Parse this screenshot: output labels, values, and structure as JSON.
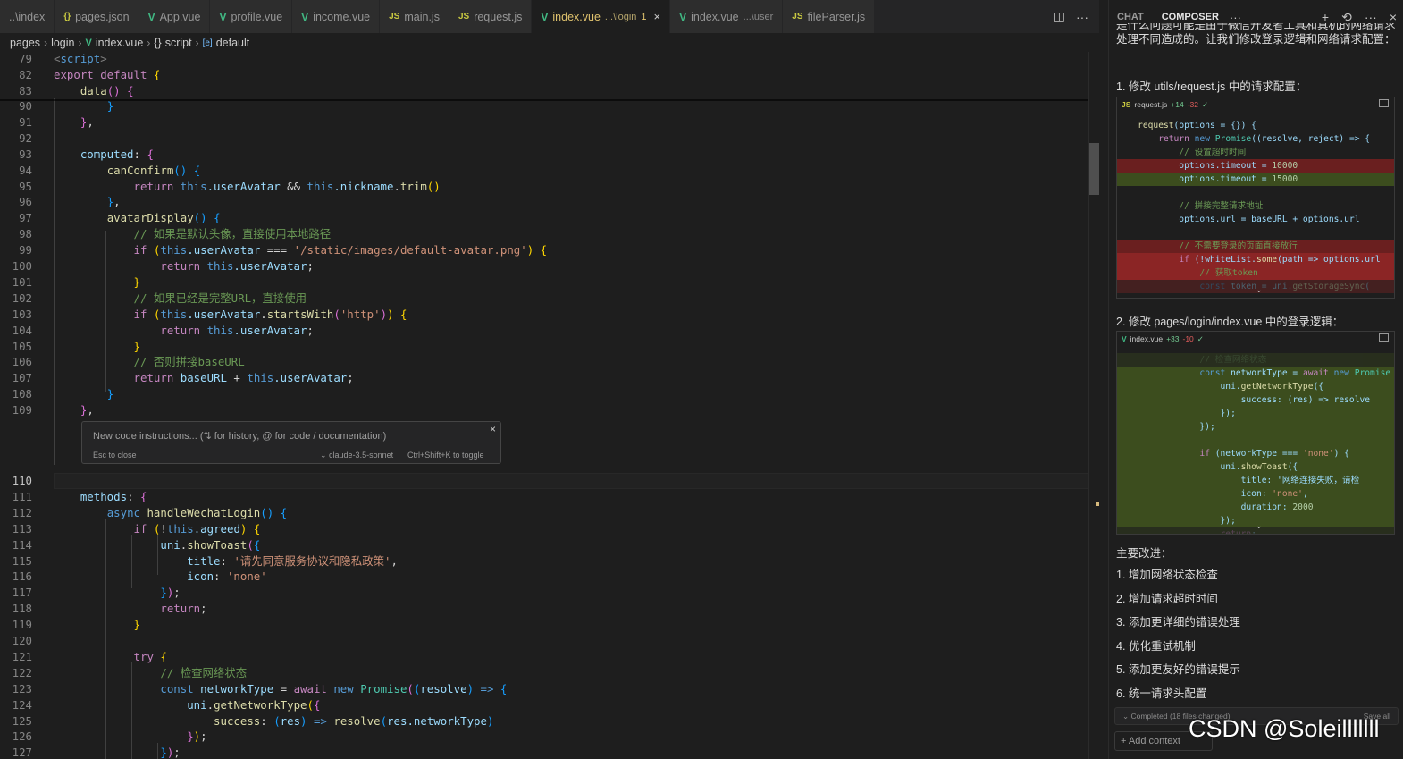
{
  "tabs": [
    {
      "name": "tab-index-partial",
      "icon": "",
      "label": "..\\index",
      "desc": "",
      "active": false
    },
    {
      "name": "tab-pages-json",
      "icon": "{}",
      "label": "pages.json",
      "desc": "",
      "active": false
    },
    {
      "name": "tab-app-vue",
      "icon": "V",
      "label": "App.vue",
      "desc": "",
      "active": false
    },
    {
      "name": "tab-profile-vue",
      "icon": "V",
      "label": "profile.vue",
      "desc": "",
      "active": false
    },
    {
      "name": "tab-income-vue",
      "icon": "V",
      "label": "income.vue",
      "desc": "",
      "active": false
    },
    {
      "name": "tab-main-js",
      "icon": "JS",
      "label": "main.js",
      "desc": "",
      "active": false
    },
    {
      "name": "tab-request-js",
      "icon": "JS",
      "label": "request.js",
      "desc": "",
      "active": false
    },
    {
      "name": "tab-index-vue-login",
      "icon": "V",
      "label": "index.vue",
      "desc": "...\\login",
      "badge": "1",
      "active": true
    },
    {
      "name": "tab-index-vue-user",
      "icon": "V",
      "label": "index.vue",
      "desc": "...\\user",
      "active": false
    },
    {
      "name": "tab-fileparser-js",
      "icon": "JS",
      "label": "fileParser.js",
      "desc": "",
      "active": false
    }
  ],
  "breadcrumb": {
    "pages": "pages",
    "login": "login",
    "file": "index.vue",
    "script": "script",
    "symbol": "default",
    "script_icon": "{}",
    "symbol_icon": "[e]"
  },
  "editor": {
    "inline_widget": {
      "placeholder": "New code instructions... (⇅ for history, @ for code / documentation)",
      "esc_hint": "Esc to close",
      "model": "⌄ claude-3.5-sonnet",
      "toggle_hint": "Ctrl+Shift+K to toggle",
      "close": "×"
    },
    "sticky_lines": [
      {
        "n": "79",
        "tokens": [
          [
            "<",
            "t-tag"
          ],
          [
            "script",
            "t-tname"
          ],
          [
            ">",
            "t-tag"
          ]
        ]
      },
      {
        "n": "82",
        "tokens": [
          [
            "export default ",
            "t-kw"
          ],
          [
            "{",
            "t-b1"
          ]
        ]
      },
      {
        "n": "83",
        "tokens": [
          [
            "    "
          ],
          [
            "data",
            "t-fn"
          ],
          [
            "()",
            "t-b2"
          ],
          [
            " "
          ],
          [
            "{",
            "t-b2"
          ]
        ]
      }
    ],
    "lines_top": [
      {
        "n": "90",
        "tokens": [
          [
            "        "
          ],
          [
            "}",
            "t-b3"
          ]
        ]
      },
      {
        "n": "91",
        "tokens": [
          [
            "    "
          ],
          [
            "}",
            "t-b2"
          ],
          [
            ",",
            "t-pl"
          ]
        ]
      },
      {
        "n": "92",
        "tokens": []
      },
      {
        "n": "93",
        "tokens": [
          [
            "    "
          ],
          [
            "computed",
            "t-pr"
          ],
          [
            ": ",
            "t-pl"
          ],
          [
            "{",
            "t-b2"
          ]
        ]
      },
      {
        "n": "94",
        "tokens": [
          [
            "        "
          ],
          [
            "canConfirm",
            "t-fn"
          ],
          [
            "()",
            "t-b3"
          ],
          [
            " "
          ],
          [
            "{",
            "t-b3"
          ]
        ]
      },
      {
        "n": "95",
        "tokens": [
          [
            "            "
          ],
          [
            "return ",
            "t-kw"
          ],
          [
            "this",
            "t-st"
          ],
          [
            ".userAvatar",
            "t-pr"
          ],
          [
            " && ",
            "t-pl"
          ],
          [
            "this",
            "t-st"
          ],
          [
            ".nickname",
            "t-pr"
          ],
          [
            ".",
            "t-pl"
          ],
          [
            "trim",
            "t-fn"
          ],
          [
            "()",
            "t-b1"
          ]
        ]
      },
      {
        "n": "96",
        "tokens": [
          [
            "        "
          ],
          [
            "}",
            "t-b3"
          ],
          [
            ",",
            "t-pl"
          ]
        ]
      },
      {
        "n": "97",
        "tokens": [
          [
            "        "
          ],
          [
            "avatarDisplay",
            "t-fn"
          ],
          [
            "()",
            "t-b3"
          ],
          [
            " "
          ],
          [
            "{",
            "t-b3"
          ]
        ]
      },
      {
        "n": "98",
        "tokens": [
          [
            "            "
          ],
          [
            "// 如果是默认头像，直接使用本地路径",
            "t-cm"
          ]
        ]
      },
      {
        "n": "99",
        "tokens": [
          [
            "            "
          ],
          [
            "if ",
            "t-kw"
          ],
          [
            "(",
            "t-b1"
          ],
          [
            "this",
            "t-st"
          ],
          [
            ".userAvatar",
            "t-pr"
          ],
          [
            " === ",
            "t-pl"
          ],
          [
            "'/static/images/default-avatar.png'",
            "t-str"
          ],
          [
            ")",
            "t-b1"
          ],
          [
            " "
          ],
          [
            "{",
            "t-b1"
          ]
        ]
      },
      {
        "n": "100",
        "tokens": [
          [
            "                "
          ],
          [
            "return ",
            "t-kw"
          ],
          [
            "this",
            "t-st"
          ],
          [
            ".userAvatar",
            "t-pr"
          ],
          [
            ";",
            "t-pl"
          ]
        ]
      },
      {
        "n": "101",
        "tokens": [
          [
            "            "
          ],
          [
            "}",
            "t-b1"
          ]
        ]
      },
      {
        "n": "102",
        "tokens": [
          [
            "            "
          ],
          [
            "// 如果已经是完整URL，直接使用",
            "t-cm"
          ]
        ]
      },
      {
        "n": "103",
        "tokens": [
          [
            "            "
          ],
          [
            "if ",
            "t-kw"
          ],
          [
            "(",
            "t-b1"
          ],
          [
            "this",
            "t-st"
          ],
          [
            ".userAvatar",
            "t-pr"
          ],
          [
            ".",
            "t-pl"
          ],
          [
            "startsWith",
            "t-fn"
          ],
          [
            "(",
            "t-b2"
          ],
          [
            "'http'",
            "t-str"
          ],
          [
            ")",
            "t-b2"
          ],
          [
            ")",
            "t-b1"
          ],
          [
            " "
          ],
          [
            "{",
            "t-b1"
          ]
        ]
      },
      {
        "n": "104",
        "tokens": [
          [
            "                "
          ],
          [
            "return ",
            "t-kw"
          ],
          [
            "this",
            "t-st"
          ],
          [
            ".userAvatar",
            "t-pr"
          ],
          [
            ";",
            "t-pl"
          ]
        ]
      },
      {
        "n": "105",
        "tokens": [
          [
            "            "
          ],
          [
            "}",
            "t-b1"
          ]
        ]
      },
      {
        "n": "106",
        "tokens": [
          [
            "            "
          ],
          [
            "// 否则拼接baseURL",
            "t-cm"
          ]
        ]
      },
      {
        "n": "107",
        "tokens": [
          [
            "            "
          ],
          [
            "return ",
            "t-kw"
          ],
          [
            "baseURL",
            "t-pr"
          ],
          [
            " + ",
            "t-pl"
          ],
          [
            "this",
            "t-st"
          ],
          [
            ".userAvatar",
            "t-pr"
          ],
          [
            ";",
            "t-pl"
          ]
        ]
      },
      {
        "n": "108",
        "tokens": [
          [
            "        "
          ],
          [
            "}",
            "t-b3"
          ]
        ]
      },
      {
        "n": "109",
        "tokens": [
          [
            "    "
          ],
          [
            "}",
            "t-b2"
          ],
          [
            ",",
            "t-pl"
          ]
        ]
      }
    ],
    "lines_bottom": [
      {
        "n": "110",
        "cur": true,
        "tokens": []
      },
      {
        "n": "111",
        "tokens": [
          [
            "    "
          ],
          [
            "methods",
            "t-pr"
          ],
          [
            ": ",
            "t-pl"
          ],
          [
            "{",
            "t-b2"
          ]
        ]
      },
      {
        "n": "112",
        "tokens": [
          [
            "        "
          ],
          [
            "async ",
            "t-st"
          ],
          [
            "handleWechatLogin",
            "t-fn"
          ],
          [
            "()",
            "t-b3"
          ],
          [
            " "
          ],
          [
            "{",
            "t-b3"
          ]
        ]
      },
      {
        "n": "113",
        "tokens": [
          [
            "            "
          ],
          [
            "if ",
            "t-kw"
          ],
          [
            "(",
            "t-b1"
          ],
          [
            "!",
            "t-pl"
          ],
          [
            "this",
            "t-st"
          ],
          [
            ".agreed",
            "t-pr"
          ],
          [
            ")",
            "t-b1"
          ],
          [
            " "
          ],
          [
            "{",
            "t-b1"
          ]
        ]
      },
      {
        "n": "114",
        "tokens": [
          [
            "                "
          ],
          [
            "uni",
            "t-pr"
          ],
          [
            ".",
            "t-pl"
          ],
          [
            "showToast",
            "t-fn"
          ],
          [
            "(",
            "t-b2"
          ],
          [
            "{",
            "t-b3"
          ]
        ]
      },
      {
        "n": "115",
        "tokens": [
          [
            "                    "
          ],
          [
            "title",
            "t-pr"
          ],
          [
            ": ",
            "t-pl"
          ],
          [
            "'请先同意服务协议和隐私政策'",
            "t-str"
          ],
          [
            ",",
            "t-pl"
          ]
        ]
      },
      {
        "n": "116",
        "tokens": [
          [
            "                    "
          ],
          [
            "icon",
            "t-pr"
          ],
          [
            ": ",
            "t-pl"
          ],
          [
            "'none'",
            "t-str"
          ]
        ]
      },
      {
        "n": "117",
        "tokens": [
          [
            "                "
          ],
          [
            "}",
            "t-b3"
          ],
          [
            ")",
            "t-b2"
          ],
          [
            ";",
            "t-pl"
          ]
        ]
      },
      {
        "n": "118",
        "tokens": [
          [
            "                "
          ],
          [
            "return",
            "t-kw"
          ],
          [
            ";",
            "t-pl"
          ]
        ]
      },
      {
        "n": "119",
        "tokens": [
          [
            "            "
          ],
          [
            "}",
            "t-b1"
          ]
        ]
      },
      {
        "n": "120",
        "tokens": []
      },
      {
        "n": "121",
        "tokens": [
          [
            "            "
          ],
          [
            "try ",
            "t-kw"
          ],
          [
            "{",
            "t-b1"
          ]
        ]
      },
      {
        "n": "122",
        "tokens": [
          [
            "                "
          ],
          [
            "// 检查网络状态",
            "t-cm"
          ]
        ]
      },
      {
        "n": "123",
        "tokens": [
          [
            "                "
          ],
          [
            "const ",
            "t-st"
          ],
          [
            "networkType",
            "t-pr"
          ],
          [
            " = ",
            "t-pl"
          ],
          [
            "await ",
            "t-kw"
          ],
          [
            "new ",
            "t-st"
          ],
          [
            "Promise",
            "t-cls"
          ],
          [
            "(",
            "t-b2"
          ],
          [
            "(",
            "t-b3"
          ],
          [
            "resolve",
            "t-pr"
          ],
          [
            ")",
            "t-b3"
          ],
          [
            " => ",
            "t-st"
          ],
          [
            "{",
            "t-b3"
          ]
        ]
      },
      {
        "n": "124",
        "tokens": [
          [
            "                    "
          ],
          [
            "uni",
            "t-pr"
          ],
          [
            ".",
            "t-pl"
          ],
          [
            "getNetworkType",
            "t-fn"
          ],
          [
            "(",
            "t-b1"
          ],
          [
            "{",
            "t-b2"
          ]
        ]
      },
      {
        "n": "125",
        "tokens": [
          [
            "                        "
          ],
          [
            "success",
            "t-fn"
          ],
          [
            ": ",
            "t-pl"
          ],
          [
            "(",
            "t-b3"
          ],
          [
            "res",
            "t-pr"
          ],
          [
            ")",
            "t-b3"
          ],
          [
            " => ",
            "t-st"
          ],
          [
            "resolve",
            "t-fn"
          ],
          [
            "(",
            "t-b3"
          ],
          [
            "res",
            "t-pr"
          ],
          [
            ".networkType",
            "t-pr"
          ],
          [
            ")",
            "t-b3"
          ]
        ]
      },
      {
        "n": "126",
        "tokens": [
          [
            "                    "
          ],
          [
            "}",
            "t-b2"
          ],
          [
            ")",
            "t-b1"
          ],
          [
            ";",
            "t-pl"
          ]
        ]
      },
      {
        "n": "127",
        "tokens": [
          [
            "                "
          ],
          [
            "}",
            "t-b3"
          ],
          [
            ")",
            "t-b2"
          ],
          [
            ";",
            "t-pl"
          ]
        ]
      }
    ]
  },
  "panel": {
    "tab_chat": "CHAT",
    "tab_composer": "COMPOSER",
    "more": "···",
    "actions": [
      "+",
      "⟲",
      "···",
      "×"
    ],
    "intro_text": "是什么问题可能是由于微信开发者工具和真机的网络请求处理不同造成的。让我们修改登录逻辑和网络请求配置：",
    "step1": "1. 修改 utils/request.js 中的请求配置：",
    "diff1": {
      "file": "request.js",
      "icon": "JS",
      "added": "+14",
      "removed": "-32",
      "check": "✓",
      "lines": [
        {
          "kind": "",
          "text": "    request(options = {}) {"
        },
        {
          "kind": "",
          "text": "        return new Promise((resolve, reject) => {"
        },
        {
          "kind": "",
          "text": "            // 设置超时时间"
        },
        {
          "kind": "rm",
          "text": "            options.timeout = 10000"
        },
        {
          "kind": "ad",
          "text": "            options.timeout = 15000"
        },
        {
          "kind": "",
          "text": ""
        },
        {
          "kind": "",
          "text": "            // 拼接完整请求地址"
        },
        {
          "kind": "",
          "text": "            options.url = baseURL + options.url"
        },
        {
          "kind": "",
          "text": ""
        },
        {
          "kind": "rm",
          "text": "            // 不需要登录的页面直接放行"
        },
        {
          "kind": "rmx",
          "text": "            if (!whiteList.some(path => options.url"
        },
        {
          "kind": "rmx",
          "text": "                // 获取token"
        },
        {
          "kind": "rmx fade",
          "text": "                const token = uni.getStorageSync("
        }
      ]
    },
    "step2": "2. 修改 pages/login/index.vue 中的登录逻辑：",
    "diff2": {
      "file": "index.vue",
      "icon": "V",
      "added": "+33",
      "removed": "-10",
      "check": "✓",
      "lines": [
        {
          "kind": "ad fade",
          "text": "                // 检查网络状态"
        },
        {
          "kind": "ad",
          "text": "                const networkType = await new Promise"
        },
        {
          "kind": "ad",
          "text": "                    uni.getNetworkType({"
        },
        {
          "kind": "ad",
          "text": "                        success: (res) => resolve"
        },
        {
          "kind": "ad",
          "text": "                    });"
        },
        {
          "kind": "ad",
          "text": "                });"
        },
        {
          "kind": "ad",
          "text": ""
        },
        {
          "kind": "ad",
          "text": "                if (networkType === 'none') {"
        },
        {
          "kind": "ad",
          "text": "                    uni.showToast({"
        },
        {
          "kind": "ad",
          "text": "                        title: '网络连接失败，请检"
        },
        {
          "kind": "ad",
          "text": "                        icon: 'none',"
        },
        {
          "kind": "ad",
          "text": "                        duration: 2000"
        },
        {
          "kind": "ad",
          "text": "                    });"
        },
        {
          "kind": "ad fade",
          "text": "                    return;"
        }
      ]
    },
    "improvements_title": "主要改进：",
    "improvements": [
      "1. 增加网络状态检查",
      "2. 增加请求超时时间",
      "3. 添加更详细的错误处理",
      "4. 优化重试机制",
      "5. 添加更友好的错误提示",
      "6. 统一请求头配置"
    ],
    "completed": "⌄ Completed (18 files changed)",
    "save_all": "Save all",
    "add_context": "+ Add context"
  },
  "watermark": "CSDN @Soleilllllll"
}
